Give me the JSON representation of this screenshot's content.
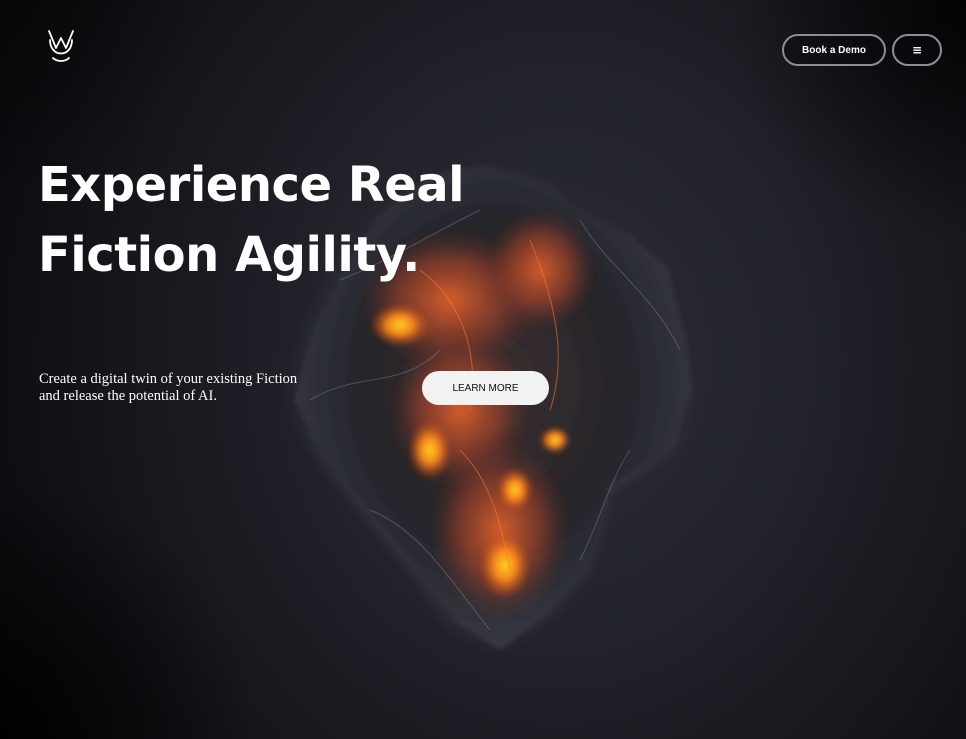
{
  "header": {
    "logo_icon": "vm-monogram-logo",
    "book_demo_label": "Book a Demo",
    "menu_icon": "hamburger-menu-icon",
    "menu_glyph": "≡"
  },
  "hero": {
    "title_line1": "Experience Real",
    "title_line2": "Fiction Agility.",
    "description_line1": "Create a digital twin of your existing Fiction",
    "description_line2": "and release the potential of AI.",
    "cta_label": "LEARN MORE"
  },
  "colors": {
    "background": "#22232b",
    "accent_fire": "#e85a1e",
    "accent_glow": "#ffc21a",
    "button_light": "#f2f2f2",
    "button_border": "#8d8f96"
  }
}
